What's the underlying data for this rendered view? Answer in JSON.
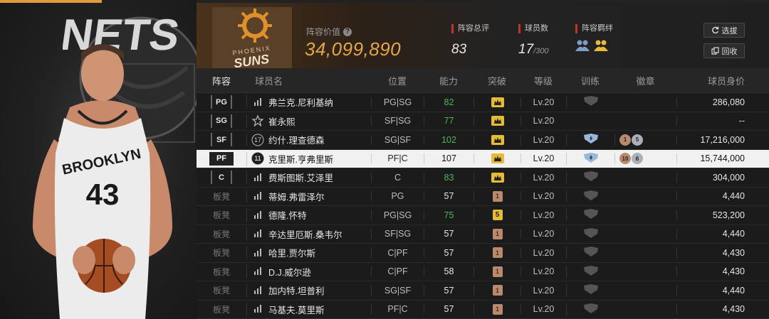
{
  "summary": {
    "team_logo_text": "PHOENIX SUNS",
    "value_label": "阵容价值",
    "value": "34,099,890",
    "overall_label": "阵容总评",
    "overall": "83",
    "count_label": "球员数",
    "count": "17",
    "count_max": "/300",
    "synergy_label": "阵容羁绊",
    "select_label": "选拔",
    "recycle_label": "回收",
    "hero_jersey_text": "BROOKLYN",
    "hero_jersey_number": "43"
  },
  "headers": {
    "lineup": "阵容",
    "player": "球员名",
    "position": "位置",
    "ability": "能力",
    "breakthrough": "突破",
    "level": "等级",
    "training": "训练",
    "badges": "徽章",
    "price": "球员身价"
  },
  "players": [
    {
      "slot": "PG",
      "name": "弗兰克.尼利基纳",
      "jersey": "",
      "pos": "PG|SG",
      "ability": "82",
      "abil_color": "green",
      "brk": "crown",
      "level": "Lv.20",
      "train": "gray",
      "badges": [],
      "price": "286,080"
    },
    {
      "slot": "SG",
      "name": "崔永熙",
      "jersey": "star",
      "pos": "SF|SG",
      "ability": "77",
      "abil_color": "green",
      "brk": "crown",
      "level": "Lv.20",
      "train": "",
      "badges": [],
      "price": "--"
    },
    {
      "slot": "SF",
      "name": "约什.理查德森",
      "jersey": "17",
      "pos": "SG|SF",
      "ability": "102",
      "abil_color": "green",
      "brk": "crown",
      "level": "Lv.20",
      "train": "blue",
      "badges": [
        {
          "t": "1",
          "c": "bronze"
        },
        {
          "t": "5",
          "c": "silver"
        }
      ],
      "price": "17,216,000"
    },
    {
      "slot": "PF",
      "name": "克里斯.亨弗里斯",
      "jersey": "11",
      "pos": "PF|C",
      "ability": "107",
      "abil_color": "",
      "brk": "crown",
      "level": "Lv.20",
      "train": "blue",
      "badges": [
        {
          "t": "10",
          "c": "bronze"
        },
        {
          "t": "6",
          "c": "silver"
        }
      ],
      "price": "15,744,000"
    },
    {
      "slot": "C",
      "name": "费斯图斯.艾泽里",
      "jersey": "",
      "pos": "C",
      "ability": "83",
      "abil_color": "green",
      "brk": "crown",
      "level": "Lv.20",
      "train": "gray",
      "badges": [],
      "price": "304,000"
    },
    {
      "slot": "板凳",
      "name": "蒂姆.弗雷泽尔",
      "jersey": "",
      "pos": "PG",
      "ability": "57",
      "abil_color": "",
      "brk": "1",
      "level": "Lv.20",
      "train": "gray",
      "badges": [],
      "price": "4,440"
    },
    {
      "slot": "板凳",
      "name": "德隆.怀特",
      "jersey": "",
      "pos": "PG|SG",
      "ability": "75",
      "abil_color": "green",
      "brk": "5",
      "level": "Lv.20",
      "train": "gray",
      "badges": [],
      "price": "523,200"
    },
    {
      "slot": "板凳",
      "name": "辛达里厄斯.桑韦尔",
      "jersey": "",
      "pos": "SF|SG",
      "ability": "57",
      "abil_color": "",
      "brk": "1",
      "level": "Lv.20",
      "train": "gray",
      "badges": [],
      "price": "4,440"
    },
    {
      "slot": "板凳",
      "name": "哈里.贾尔斯",
      "jersey": "",
      "pos": "C|PF",
      "ability": "57",
      "abil_color": "",
      "brk": "1",
      "level": "Lv.20",
      "train": "gray",
      "badges": [],
      "price": "4,430"
    },
    {
      "slot": "板凳",
      "name": "D.J.威尔逊",
      "jersey": "",
      "pos": "C|PF",
      "ability": "58",
      "abil_color": "",
      "brk": "1",
      "level": "Lv.20",
      "train": "gray",
      "badges": [],
      "price": "4,430"
    },
    {
      "slot": "板凳",
      "name": "加内特.坦普利",
      "jersey": "",
      "pos": "SG|SF",
      "ability": "57",
      "abil_color": "",
      "brk": "1",
      "level": "Lv.20",
      "train": "gray",
      "badges": [],
      "price": "4,440"
    },
    {
      "slot": "板凳",
      "name": "马基夫.莫里斯",
      "jersey": "",
      "pos": "PF|C",
      "ability": "57",
      "abil_color": "",
      "brk": "1",
      "level": "Lv.20",
      "train": "gray",
      "badges": [],
      "price": "4,430"
    }
  ],
  "selected_row": 3
}
